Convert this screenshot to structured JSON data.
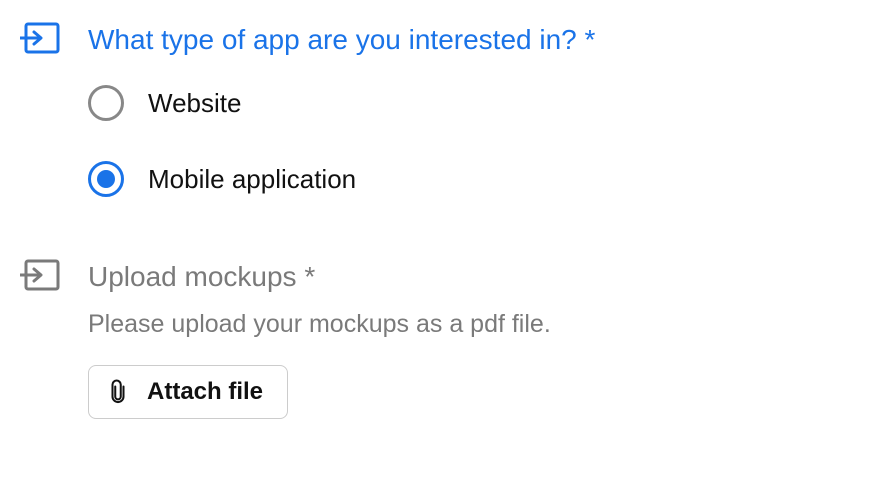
{
  "q1": {
    "title": "What type of app are you interested in? *",
    "options": [
      {
        "label": "Website",
        "selected": false
      },
      {
        "label": "Mobile application",
        "selected": true
      }
    ]
  },
  "q2": {
    "title": "Upload mockups *",
    "helper": "Please upload your mockups as a pdf file.",
    "attach_label": "Attach file"
  }
}
